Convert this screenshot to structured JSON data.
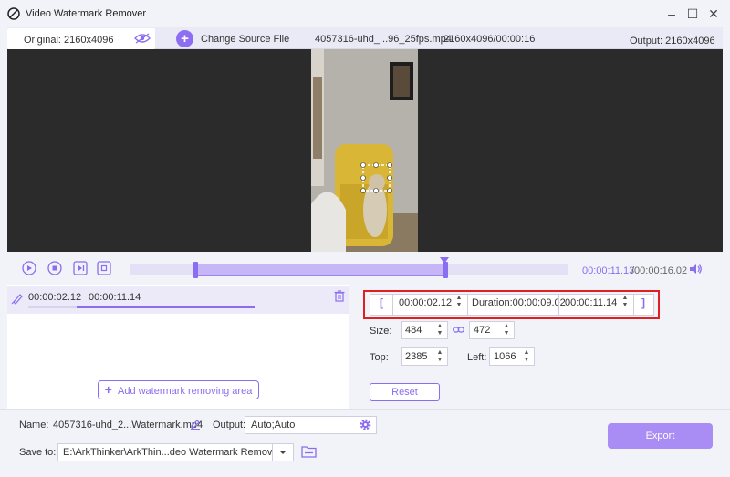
{
  "window": {
    "title": "Video Watermark Remover",
    "icons": {
      "app": "watermark-remover-app-icon",
      "minimize": "minimize-icon",
      "maximize": "maximize-icon",
      "close": "close-icon"
    }
  },
  "infobar": {
    "original_label": "Original: 2160x4096",
    "change_source": "Change Source File",
    "file_name": "4057316-uhd_...96_25fps.mp4",
    "file_dims": "2160x4096/00:00:16",
    "output_label": "Output: 2160x4096",
    "icons": {
      "preview": "eye-icon",
      "add": "plus-circle-icon"
    }
  },
  "playback": {
    "time_current": "00:00:11.13",
    "time_total": "/00:00:16.02",
    "selection_start_fraction": 0.148,
    "selection_end_fraction": 0.72,
    "playhead_fraction": 0.709,
    "icons": {
      "play": "play-icon",
      "stop": "stop-icon",
      "prev_frame": "previous-frame-icon",
      "next_frame": "next-frame-icon",
      "volume": "volume-icon"
    }
  },
  "segment": {
    "start": "00:00:02.12",
    "end": "00:00:11.14",
    "add_area_label": "Add watermark removing area",
    "icons": {
      "segment": "brush-icon",
      "delete": "trash-icon"
    }
  },
  "settings": {
    "range_start": "00:00:02.12",
    "duration": "Duration:00:00:09.02",
    "range_end": "00:00:11.14",
    "open_bracket": "[",
    "close_bracket": "]",
    "size_label": "Size:",
    "size_w": "484",
    "size_h": "472",
    "top_label": "Top:",
    "top_value": "2385",
    "left_label": "Left:",
    "left_value": "1066",
    "reset_label": "Reset",
    "icons": {
      "link": "link-icon"
    }
  },
  "bottom": {
    "name_label": "Name:",
    "name_value": "4057316-uhd_2...Watermark.mp4",
    "output_label": "Output:",
    "output_value": "Auto;Auto",
    "save_label": "Save to:",
    "save_path": "E:\\ArkThinker\\ArkThin...deo Watermark Remover",
    "export_label": "Export",
    "icons": {
      "edit": "pencil-icon",
      "settings": "gear-icon",
      "dropdown": "chevron-down-icon",
      "folder": "folder-icon"
    }
  },
  "colors": {
    "accent": "#8a6df0",
    "highlight": "#e02020",
    "export": "#a98cf4"
  }
}
